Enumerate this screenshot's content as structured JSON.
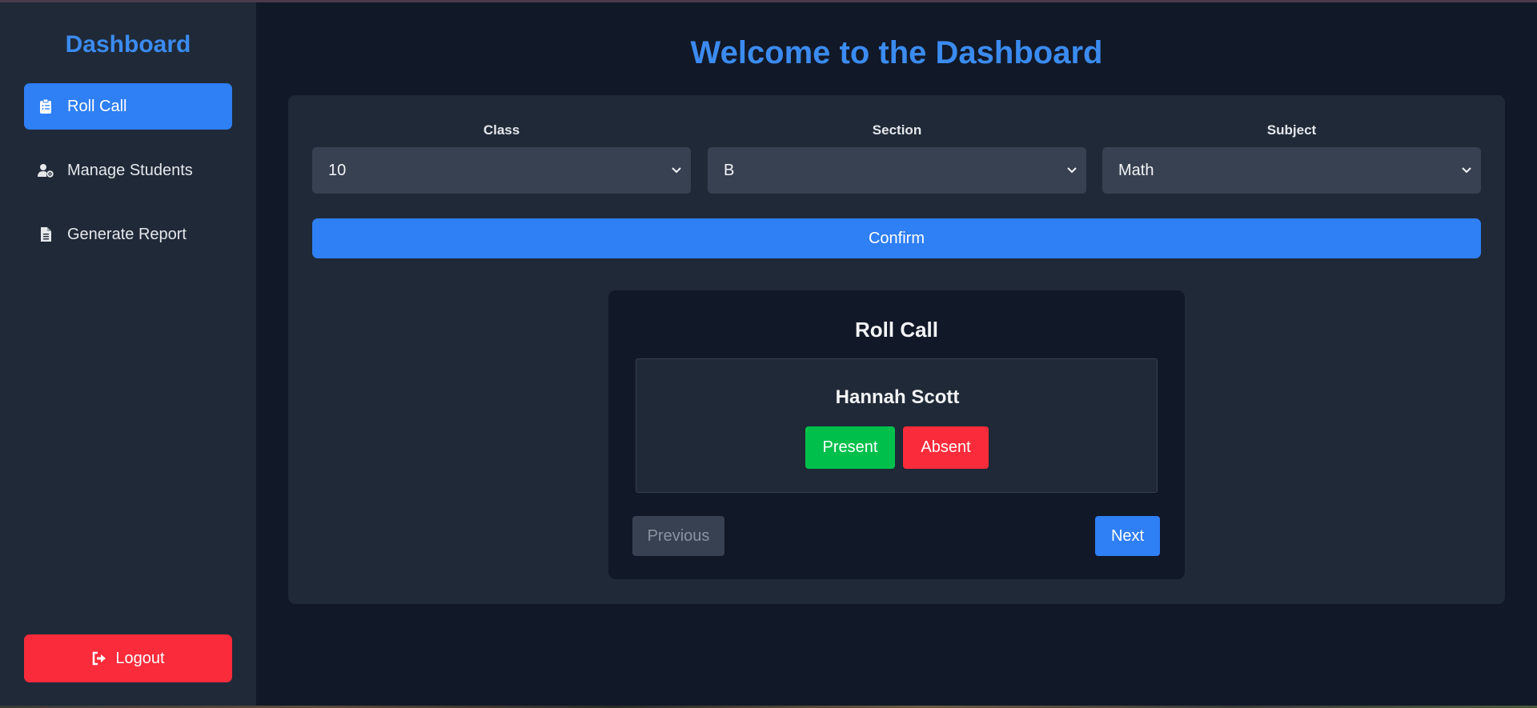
{
  "sidebar": {
    "brand": "Dashboard",
    "items": [
      {
        "label": "Roll Call",
        "icon": "clipboard-list-icon",
        "active": true
      },
      {
        "label": "Manage Students",
        "icon": "user-gear-icon",
        "active": false
      },
      {
        "label": "Generate Report",
        "icon": "file-lines-icon",
        "active": false
      }
    ],
    "logout_label": "Logout"
  },
  "main": {
    "title": "Welcome to the Dashboard",
    "filters": {
      "class_label": "Class",
      "class_value": "10",
      "section_label": "Section",
      "section_value": "B",
      "subject_label": "Subject",
      "subject_value": "Math"
    },
    "confirm_label": "Confirm",
    "roll_call": {
      "title": "Roll Call",
      "student_name": "Hannah Scott",
      "present_label": "Present",
      "absent_label": "Absent",
      "previous_label": "Previous",
      "next_label": "Next"
    }
  },
  "colors": {
    "accent": "#2f7ff5",
    "title_blue": "#3b8bf0",
    "danger": "#fa2b3a",
    "success": "#00c04b",
    "background": "#111827",
    "panel": "#1f2937"
  }
}
